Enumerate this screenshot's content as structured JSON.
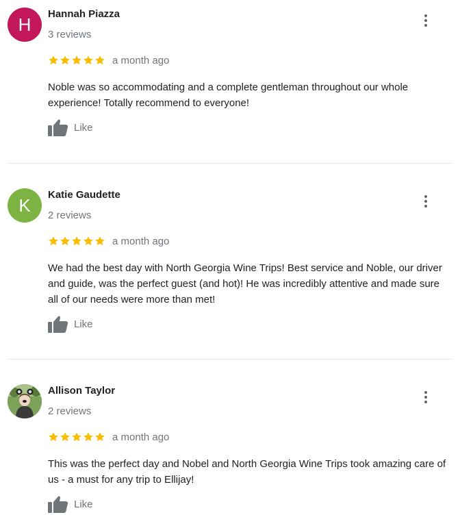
{
  "colors": {
    "star": "#fbbc04",
    "muted_text": "#70757a",
    "body_text": "#202124"
  },
  "reviews": [
    {
      "avatar": {
        "letter": "H",
        "color": "#c2185b",
        "icon": "letter-avatar"
      },
      "name": "Hannah Piazza",
      "review_count": "3 reviews",
      "rating": 5,
      "date": "a month ago",
      "text": "Noble was so accommodating and a complete gentleman throughout our whole experience! Totally recommend to everyone!",
      "like_label": "Like"
    },
    {
      "avatar": {
        "letter": "K",
        "color": "#7cb342",
        "icon": "letter-avatar"
      },
      "name": "Katie Gaudette",
      "review_count": "2 reviews",
      "rating": 5,
      "date": "a month ago",
      "text": "We had the best day with North Georgia Wine Trips! Best service and Noble, our driver and guide, was the perfect guest (and hot)! He was incredibly attentive and made sure all of our needs were more than met!",
      "like_label": "Like"
    },
    {
      "avatar": {
        "letter": "",
        "color": "#6b8f4e",
        "icon": "photo-avatar"
      },
      "name": "Allison Taylor",
      "review_count": "2 reviews",
      "rating": 5,
      "date": "a month ago",
      "text": "This was the perfect day and Nobel and North Georgia Wine Trips took amazing care of us - a must for any trip to Ellijay!",
      "like_label": "Like"
    }
  ]
}
